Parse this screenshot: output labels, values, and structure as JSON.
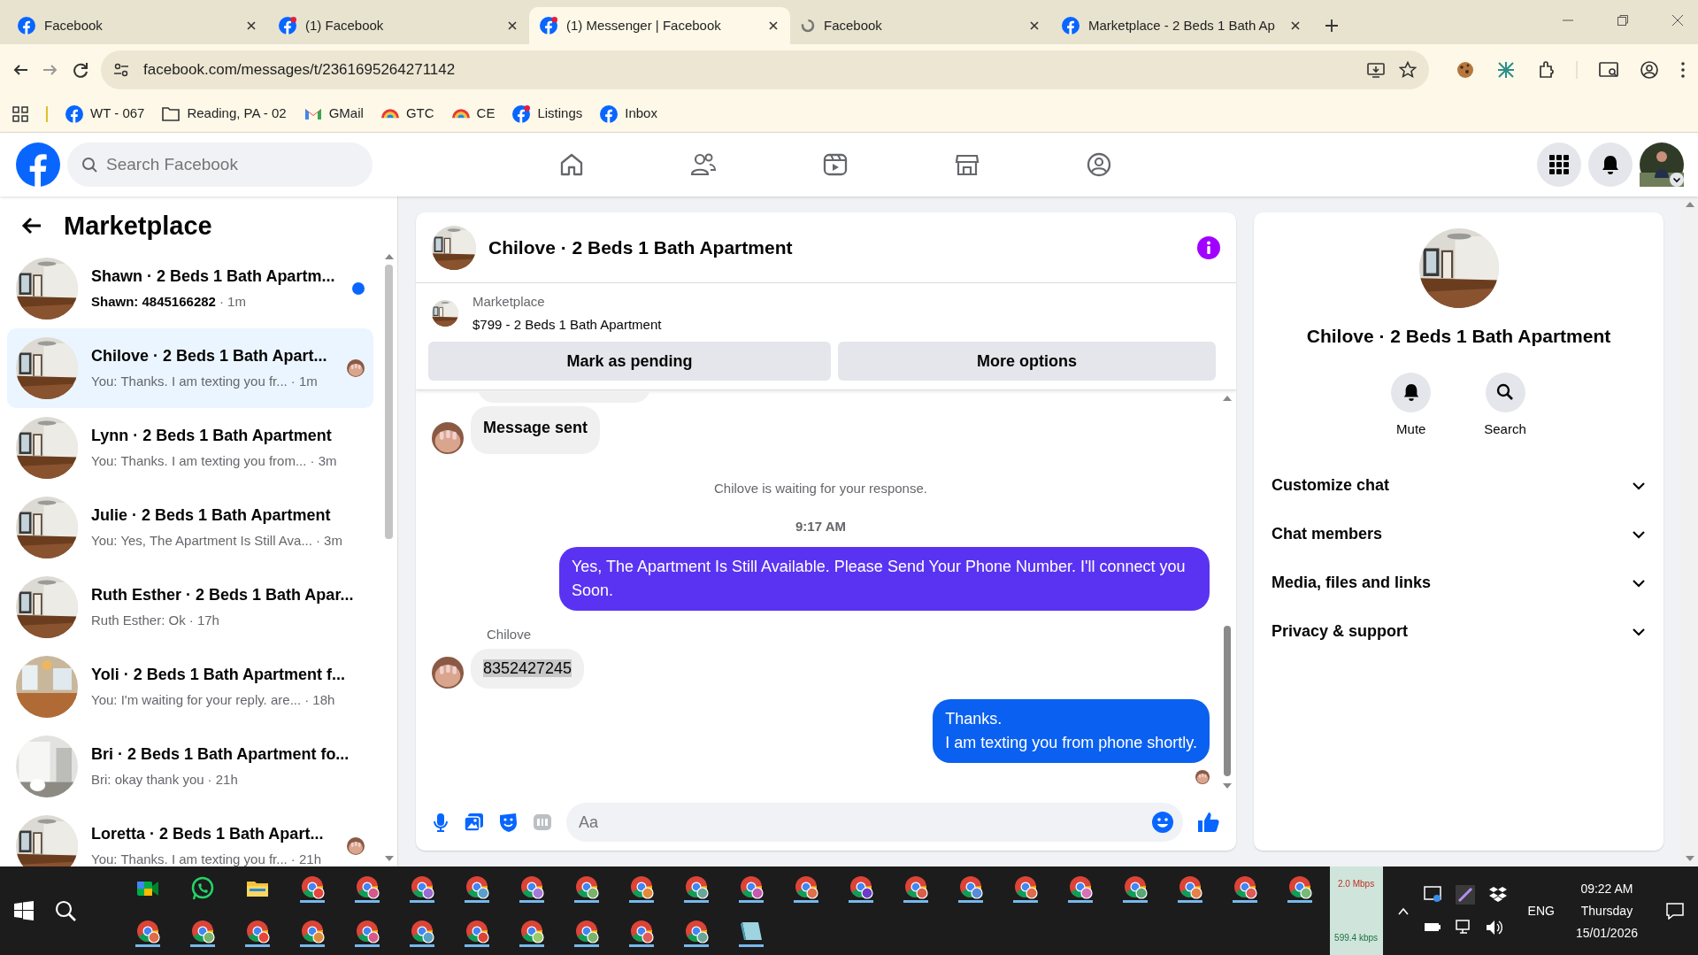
{
  "browser": {
    "tabs": [
      {
        "title": "Facebook",
        "kind": "facebook",
        "badge": false,
        "selected": false
      },
      {
        "title": "(1) Facebook",
        "kind": "facebook",
        "badge": true,
        "selected": false
      },
      {
        "title": "(1) Messenger | Facebook",
        "kind": "facebook",
        "badge": true,
        "selected": true
      },
      {
        "title": "Facebook",
        "kind": "loading",
        "badge": false,
        "selected": false
      },
      {
        "title": "Marketplace - 2 Beds 1 Bath Ap",
        "kind": "facebook",
        "badge": false,
        "selected": false
      }
    ],
    "url": "facebook.com/messages/t/2361695264271142",
    "bookmarks": [
      {
        "label": "WT - 067",
        "kind": "facebook",
        "badge": false
      },
      {
        "label": "Reading, PA - 02",
        "kind": "folder",
        "badge": false
      },
      {
        "label": "GMail",
        "kind": "gmail",
        "badge": false
      },
      {
        "label": "GTC",
        "kind": "rainbow",
        "badge": false
      },
      {
        "label": "CE",
        "kind": "rainbow",
        "badge": false
      },
      {
        "label": "Listings",
        "kind": "facebook",
        "badge": true
      },
      {
        "label": "Inbox",
        "kind": "facebook",
        "badge": false
      }
    ]
  },
  "header": {
    "search": {
      "placeholder": "Search Facebook"
    }
  },
  "sidebar": {
    "title": "Marketplace",
    "conversations": [
      {
        "title": "Shawn · 2 Beds 1 Bath Apartm...",
        "preview": "Shawn: 4845166282",
        "time": "· 1m",
        "unread": true,
        "seen": false,
        "selected": false
      },
      {
        "title": "Chilove · 2 Beds 1 Bath Apart...",
        "preview": "You: Thanks. I am texting you fr...",
        "time": "· 1m",
        "unread": false,
        "seen": true,
        "selected": true
      },
      {
        "title": "Lynn · 2 Beds 1 Bath Apartment",
        "preview": "You: Thanks. I am texting you from...",
        "time": "· 3m",
        "unread": false,
        "seen": false,
        "selected": false
      },
      {
        "title": "Julie · 2 Beds 1 Bath Apartment",
        "preview": "You: Yes, The Apartment Is Still Ava...",
        "time": "· 3m",
        "unread": false,
        "seen": false,
        "selected": false
      },
      {
        "title": "Ruth Esther · 2 Beds 1 Bath Apar...",
        "preview": "Ruth Esther: Ok",
        "time": "· 17h",
        "unread": false,
        "seen": false,
        "selected": false
      },
      {
        "title": "Yoli · 2 Beds 1 Bath Apartment f...",
        "preview": "You: I'm waiting for your reply. are...",
        "time": "· 18h",
        "unread": false,
        "seen": false,
        "selected": false
      },
      {
        "title": "Bri · 2 Beds 1 Bath Apartment fo...",
        "preview": "Bri: okay thank you",
        "time": "· 21h",
        "unread": false,
        "seen": false,
        "selected": false
      },
      {
        "title": "Loretta · 2 Beds 1 Bath Apart...",
        "preview": "You: Thanks. I am texting you fr...",
        "time": "· 21h",
        "unread": false,
        "seen": true,
        "selected": false
      }
    ]
  },
  "chat": {
    "title": "Chilove · 2 Beds 1 Bath Apartment",
    "listing": {
      "source": "Marketplace",
      "item": "$799 - 2 Beds 1 Bath Apartment"
    },
    "buttons": [
      "Mark as pending",
      "More options"
    ],
    "messages": [
      {
        "kind": "cut"
      },
      {
        "kind": "incoming",
        "text": "Message sent",
        "emphasis": true,
        "highlighted": false
      },
      {
        "kind": "notice",
        "text": "Chilove is waiting for your response."
      },
      {
        "kind": "timestamp",
        "text": "9:17 AM"
      },
      {
        "kind": "outgoing",
        "text": "Yes, The Apartment Is Still Available. Please Send Your Phone Number. I'll connect you Soon.",
        "color": "#5a33f2"
      },
      {
        "kind": "sender",
        "text": "Chilove"
      },
      {
        "kind": "incoming",
        "text": "8352427245",
        "emphasis": false,
        "highlighted": true
      },
      {
        "kind": "outgoing",
        "text": "Thanks.\nI am texting you from phone shortly.",
        "color": "#0a60f0"
      }
    ],
    "composer": {
      "placeholder": "Aa"
    }
  },
  "info": {
    "title": "Chilove · 2 Beds 1 Bath Apartment",
    "actions": [
      {
        "label": "Mute",
        "kind": "bell"
      },
      {
        "label": "Search",
        "kind": "search"
      }
    ],
    "sections": [
      {
        "label": "Customize chat",
        "expanded": false
      },
      {
        "label": "Chat members",
        "expanded": false
      },
      {
        "label": "Media, files and links",
        "expanded": false
      },
      {
        "label": "Privacy & support",
        "expanded": false
      }
    ]
  },
  "taskbar": {
    "upload": "2.0 Mbps",
    "download": "599.4 kbps",
    "language": "ENG",
    "time": "09:22 AM",
    "day": "Thursday",
    "date": "15/01/2026"
  }
}
